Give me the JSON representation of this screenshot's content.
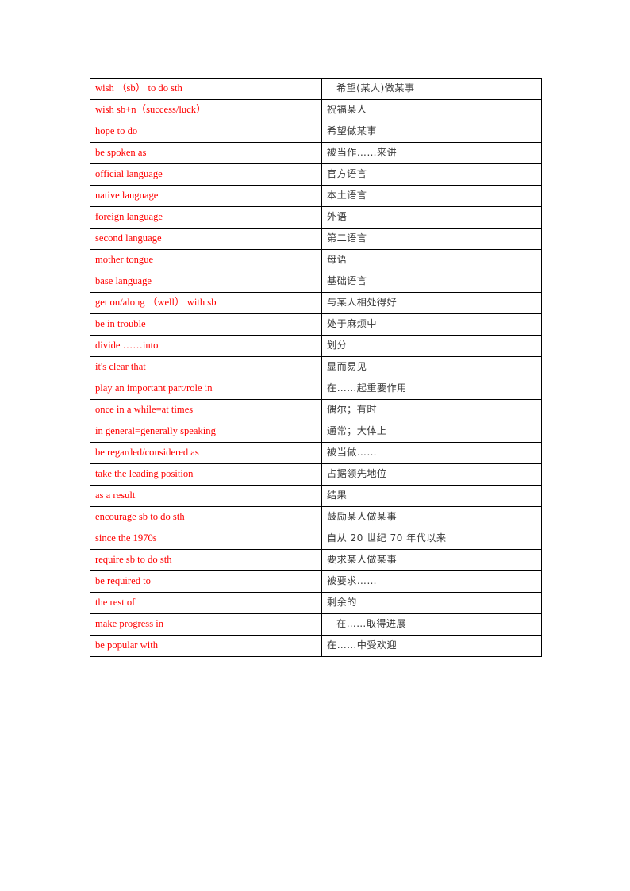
{
  "document": {
    "type": "vocabulary-phrase-table",
    "header_rule_visible": true,
    "colors": {
      "english_text": "#ff0000",
      "chinese_text": "#3a3a3a",
      "table_border": "#000000",
      "page_background": "#ffffff"
    }
  },
  "table": {
    "columns": [
      "english",
      "chinese"
    ],
    "rows": [
      {
        "english": "wish （sb） to do sth",
        "chinese": "希望(某人)做某事",
        "chinese_indent": true
      },
      {
        "english": "wish sb+n（success/luck）",
        "chinese": "祝福某人",
        "chinese_indent": false
      },
      {
        "english": "hope to do",
        "chinese": "希望做某事",
        "chinese_indent": false
      },
      {
        "english": "be spoken as",
        "chinese": "被当作……来讲",
        "chinese_indent": false
      },
      {
        "english": "official language",
        "chinese": "官方语言",
        "chinese_indent": false
      },
      {
        "english": "native language",
        "chinese": "本土语言",
        "chinese_indent": false
      },
      {
        "english": "foreign language",
        "chinese": "外语",
        "chinese_indent": false
      },
      {
        "english": "second language",
        "chinese": "第二语言",
        "chinese_indent": false
      },
      {
        "english": "mother tongue",
        "chinese": "母语",
        "chinese_indent": false
      },
      {
        "english": "base language",
        "chinese": "基础语言",
        "chinese_indent": false
      },
      {
        "english": "get on/along （well） with sb",
        "chinese": "与某人相处得好",
        "chinese_indent": false
      },
      {
        "english": "be in trouble",
        "chinese": "处于麻烦中",
        "chinese_indent": false
      },
      {
        "english": "divide ……into",
        "chinese": "划分",
        "chinese_indent": false
      },
      {
        "english": "it's clear that",
        "chinese": "显而易见",
        "chinese_indent": false
      },
      {
        "english": "play an important part/role in",
        "chinese": "在……起重要作用",
        "chinese_indent": false
      },
      {
        "english": "once in a while=at times",
        "chinese": "偶尔；有时",
        "chinese_indent": false
      },
      {
        "english": "in general=generally speaking",
        "chinese": "通常；大体上",
        "chinese_indent": false
      },
      {
        "english": "be regarded/considered as",
        "chinese": "被当做……",
        "chinese_indent": false
      },
      {
        "english": "take the leading position",
        "chinese": "占据领先地位",
        "chinese_indent": false
      },
      {
        "english": "as a result",
        "chinese": "结果",
        "chinese_indent": false
      },
      {
        "english": "encourage sb to do sth",
        "chinese": "鼓励某人做某事",
        "chinese_indent": false
      },
      {
        "english": "since the 1970s",
        "chinese": "自从 20 世纪 70 年代以来",
        "chinese_indent": false
      },
      {
        "english": "require sb to do sth",
        "chinese": "要求某人做某事",
        "chinese_indent": false
      },
      {
        "english": "be required to",
        "chinese": "被要求……",
        "chinese_indent": false
      },
      {
        "english": "the rest of",
        "chinese": "剩余的",
        "chinese_indent": false
      },
      {
        "english": "make progress in",
        "chinese": "在……取得进展",
        "chinese_indent": true
      },
      {
        "english": "be popular with",
        "chinese": "在……中受欢迎",
        "chinese_indent": false
      }
    ]
  }
}
